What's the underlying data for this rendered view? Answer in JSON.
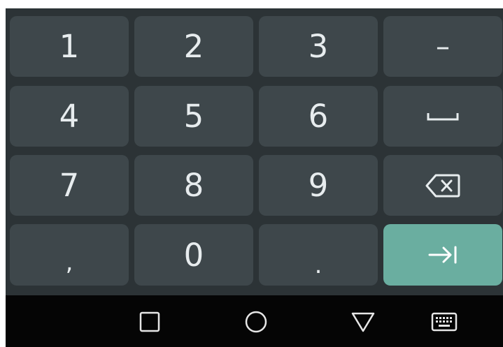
{
  "keyboard": {
    "keys": {
      "one": "1",
      "two": "2",
      "three": "3",
      "minus": "–",
      "four": "4",
      "five": "5",
      "six": "6",
      "seven": "7",
      "eight": "8",
      "nine": "9",
      "comma": ",",
      "zero": "0",
      "period": "."
    },
    "icons": {
      "space": "space-icon",
      "backspace": "backspace-icon",
      "tab": "tab-next-icon"
    },
    "colors": {
      "background": "#2c3336",
      "key": "#3e474b",
      "key_text": "#e7ecee",
      "action_key": "#6aaea0"
    }
  },
  "navbar": {
    "icons": [
      "recent-apps-icon",
      "home-icon",
      "back-icon",
      "keyboard-icon"
    ],
    "background": "#050505"
  }
}
